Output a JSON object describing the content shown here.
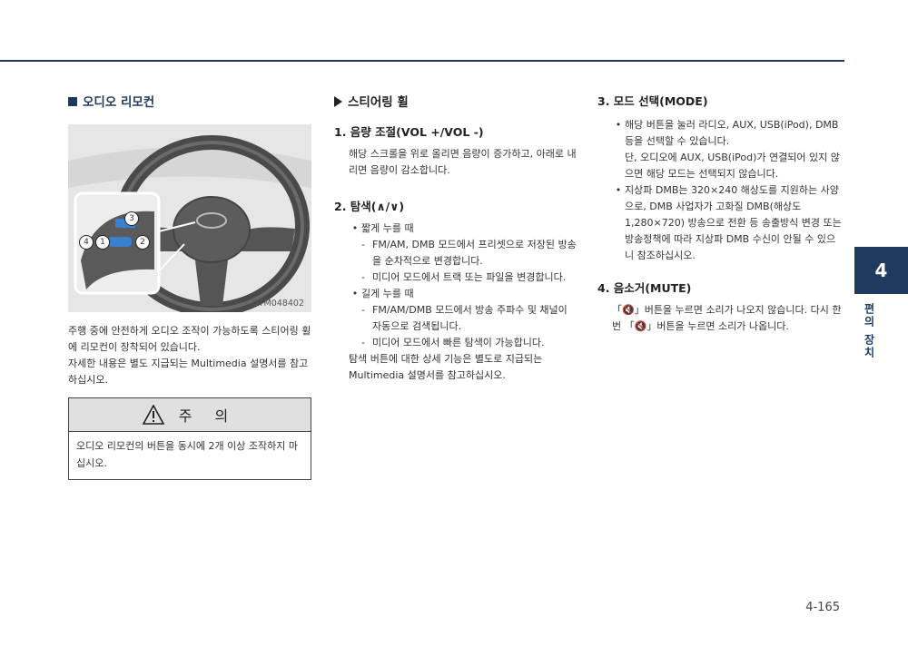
{
  "left": {
    "title": "오디오 리모컨",
    "figure_code": "OTM048402",
    "callouts": [
      "1",
      "2",
      "3",
      "4"
    ],
    "paragraphs": [
      "주행 중에 안전하게 오디오 조작이 가능하도록 스티어링 휠에 리모컨이 장착되어 있습니다.",
      "자세한 내용은 별도 지급되는 Multimedia 설명서를 참고하십시오."
    ],
    "caution": {
      "title": "주 의",
      "text": "오디오 리모컨의 버튼을 동시에 2개 이상 조작하지 마십시오."
    }
  },
  "middle": {
    "title": "스티어링 휠",
    "section1": {
      "heading": "1. 음량 조절(VOL +/VOL -)",
      "text": "해당 스크롤을 위로 올리면 음량이 증가하고, 아래로 내리면 음량이 감소합니다."
    },
    "section2": {
      "heading": "2. 탐색(∧/∨)",
      "short_label": "짧게 누를 때",
      "short_items": [
        "FM/AM, DMB 모드에서 프리셋으로 저장된 방송을 순차적으로 변경합니다.",
        "미디어 모드에서 트랙 또는 파일을 변경합니다."
      ],
      "long_label": "길게 누를 때",
      "long_items": [
        "FM/AM/DMB 모드에서 방송 주파수 및 채널이 자동으로 검색됩니다.",
        "미디어 모드에서 빠른 탐색이 가능합니다."
      ],
      "note": "탐색 버튼에 대한 상세 기능은 별도로 지급되는 Multimedia 설명서를 참고하십시오."
    }
  },
  "right": {
    "section3": {
      "heading": "3. 모드 선택(MODE)",
      "bullet1": "해당 버튼을 눌러 라디오, AUX, USB(iPod), DMB 등을 선택할 수 있습니다.",
      "bullet1_note": "단, 오디오에 AUX, USB(iPod)가 연결되어 있지 않으면 해당 모드는 선택되지 않습니다.",
      "bullet2": "지상파 DMB는 320×240 해상도를 지원하는 사양으로, DMB 사업자가 고화질 DMB(해상도 1,280×720) 방송으로 전환 등 송출방식 변경 또는 방송정책에 따라 지상파 DMB 수신이 안될 수 있으니 참조하십시오."
    },
    "section4": {
      "heading": "4. 음소거(MUTE)",
      "text": "「🔇」버튼을 누르면 소리가 나오지 않습니다. 다시 한 번 「🔇」버튼을 누르면 소리가 나옵니다."
    }
  },
  "side_tab": {
    "number": "4",
    "label": "편의 장치"
  },
  "page_number": "4-165",
  "colors": {
    "accent": "#1e3a5f",
    "figure_bg": "#e6e6e6",
    "caution_bg": "#e0e0e0"
  }
}
